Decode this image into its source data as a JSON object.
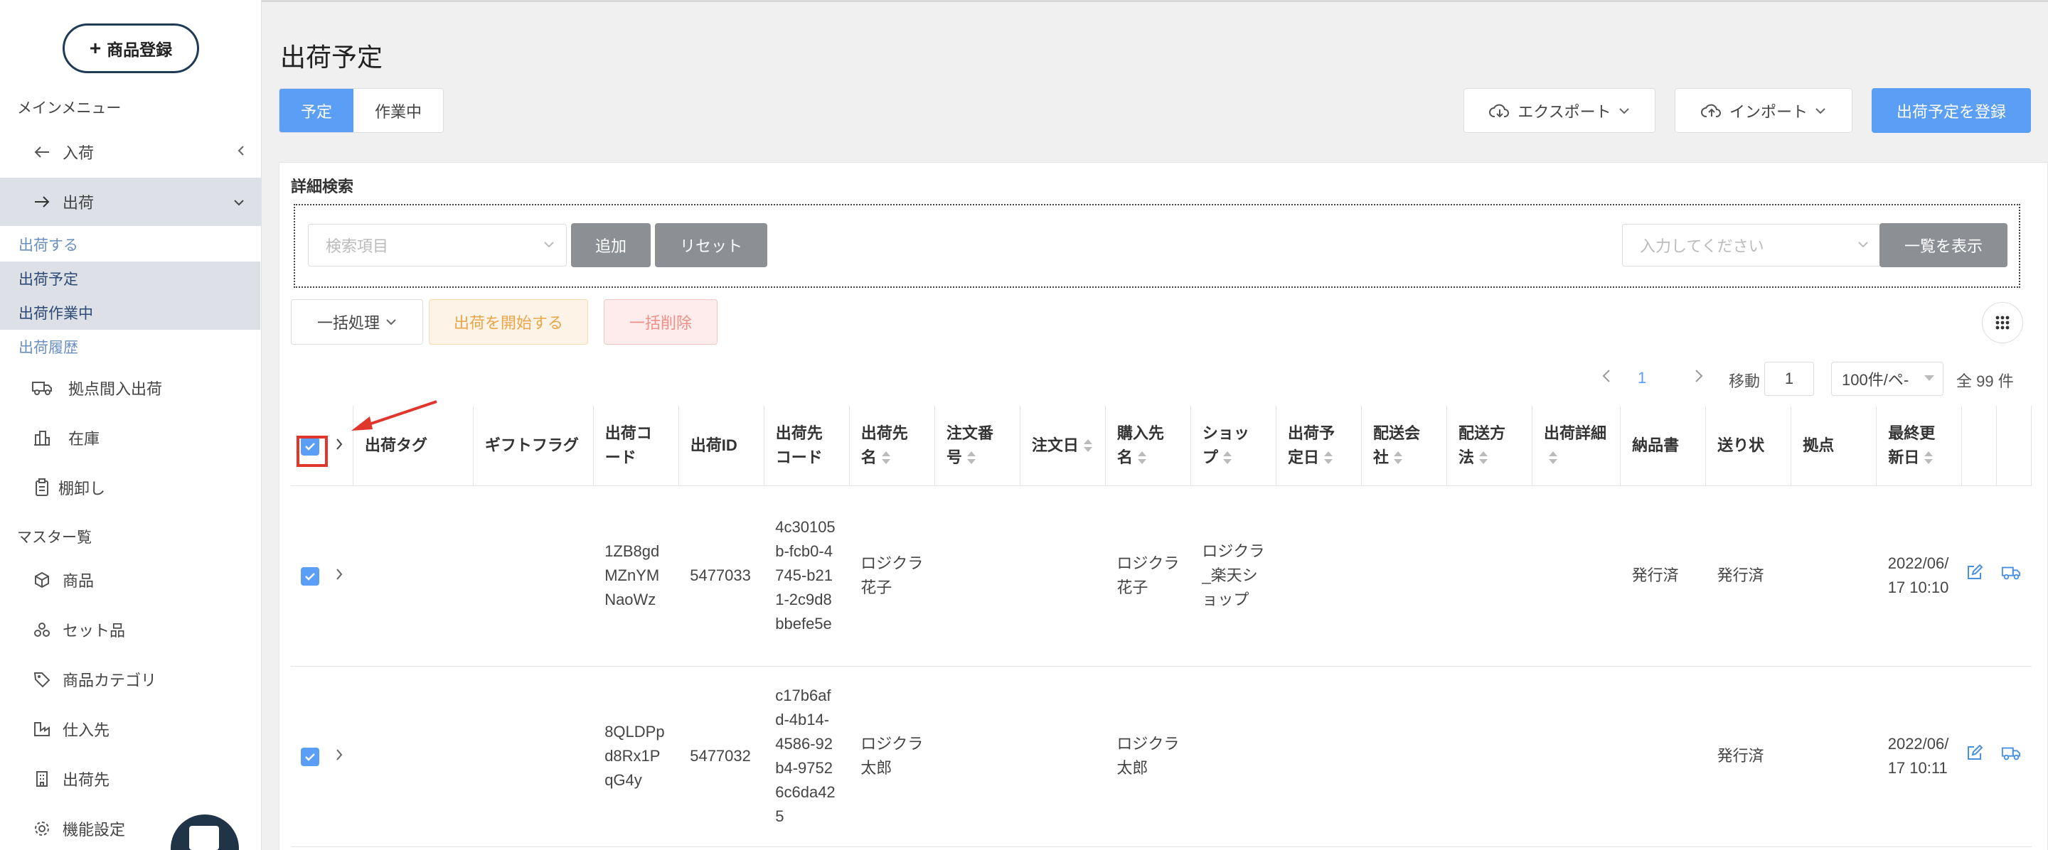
{
  "sidebar": {
    "register_button": "商品登録",
    "main_menu": "メインメニュー",
    "nav_inbound": "入荷",
    "nav_outbound": "出荷",
    "sub_ship": "出荷する",
    "sub_planned": "出荷予定",
    "sub_working": "出荷作業中",
    "sub_history": "出荷履歴",
    "nav_transfer": "拠点間入出荷",
    "nav_stock": "在庫",
    "nav_inventory": "棚卸し",
    "master": "マスター覧",
    "nav_product": "商品",
    "nav_set": "セット品",
    "nav_category": "商品カテゴリ",
    "nav_supplier": "仕入先",
    "nav_destination": "出荷先",
    "nav_settings": "機能設定"
  },
  "header": {
    "title": "出荷予定",
    "tab_planned": "予定",
    "tab_working": "作業中",
    "export": "エクスポート",
    "import": "インポート",
    "register": "出荷予定を登録"
  },
  "search": {
    "title": "詳細検索",
    "item_placeholder": "検索項目",
    "add": "追加",
    "reset": "リセット",
    "input_placeholder": "入力してください",
    "show_list": "一覧を表示"
  },
  "actions": {
    "bulk": "一括処理",
    "start": "出荷を開始する",
    "delete": "一括削除"
  },
  "pager": {
    "page": "1",
    "move": "移動",
    "move_value": "1",
    "per_page": "100件/ペ-",
    "total": "全 99 件"
  },
  "table": {
    "headers": [
      "出荷タグ",
      "ギフトフラグ",
      "出荷コード",
      "出荷ID",
      "出荷先コード",
      "出荷先名",
      "注文番号",
      "注文日",
      "購入先名",
      "ショップ",
      "出荷予定日",
      "配送会社",
      "配送方法",
      "出荷詳細",
      "納品書",
      "送り状",
      "拠点",
      "最終更新日"
    ],
    "rows": [
      {
        "code": "1ZB8gdMZnYMNaoWz",
        "id": "5477033",
        "dest_code": "4c30105b-fcb0-4745-b211-2c9d8bbefe5e",
        "dest_name": "ロジクラ　花子",
        "order_no": "",
        "order_date": "",
        "buyer": "ロジクラ　花子",
        "shop": "ロジクラ_楽天ショップ",
        "plan_date": "",
        "carrier": "",
        "method": "",
        "detail": "",
        "invoice": "発行済",
        "slip": "発行済",
        "base": "",
        "updated": "2022/06/17 10:10"
      },
      {
        "code": "8QLDPpd8Rx1PqG4y",
        "id": "5477032",
        "dest_code": "c17b6afd-4b14-4586-92b4-97526c6da425",
        "dest_name": "ロジクラ　太郎",
        "order_no": "",
        "order_date": "",
        "buyer": "ロジクラ　太郎",
        "shop": "",
        "plan_date": "",
        "carrier": "",
        "method": "",
        "detail": "",
        "invoice": "",
        "slip": "発行済",
        "base": "",
        "updated": "2022/06/17 10:11"
      }
    ]
  },
  "colors": {
    "accent": "#5b9ef5",
    "highlight": "#e0362c"
  }
}
